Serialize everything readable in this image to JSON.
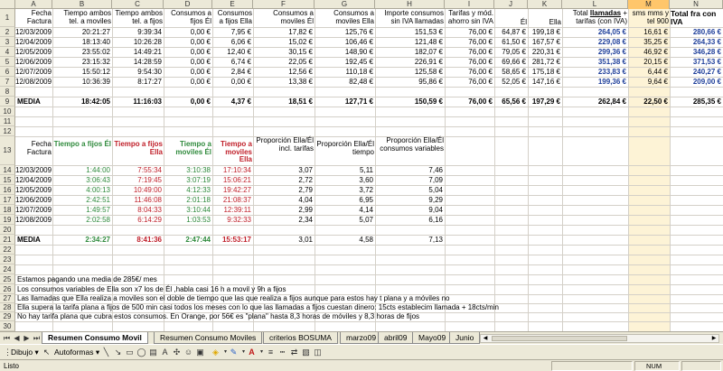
{
  "columns": [
    "A",
    "B",
    "C",
    "D",
    "E",
    "F",
    "G",
    "H",
    "I",
    "J",
    "K",
    "L",
    "M",
    "N"
  ],
  "selected_column": "M",
  "rows": [
    "1",
    "2",
    "3",
    "4",
    "5",
    "6",
    "7",
    "8",
    "9",
    "10",
    "11",
    "12",
    "13",
    "14",
    "15",
    "16",
    "17",
    "18",
    "19",
    "20",
    "21",
    "22",
    "23",
    "24",
    "25",
    "26",
    "27",
    "28",
    "29",
    "30",
    "31"
  ],
  "table1": {
    "headers": {
      "a": "Fecha Factura",
      "b": "Tiempo ambos tel. a moviles",
      "c": "Tiempo ambos tel. a fijos",
      "d": "Consumos a fijos Él",
      "e": "Consumos a fijos Ella",
      "f": "Consumos a moviles Él",
      "g": "Consumos a moviles Ella",
      "h": "Importe consumos sin IVA llamadas",
      "i": "Tarifas y mód. ahorro sin IVA",
      "j": "Él",
      "k": "Ella",
      "l_prefix": "Total ",
      "l_bold": "llamadas",
      "l_suffix": " + tarifas (con IVA)",
      "m": "sms mms y tel 900",
      "n": "Total fra con IVA"
    },
    "rows": [
      [
        "12/03/2009",
        "20:21:27",
        "9:39:34",
        "0,00 €",
        "7,95 €",
        "17,82 €",
        "125,76 €",
        "151,53 €",
        "76,00 €",
        "64,87 €",
        "199,18 €",
        "264,05 €",
        "16,61 €",
        "280,66 €"
      ],
      [
        "12/04/2009",
        "18:13:40",
        "10:26:28",
        "0,00 €",
        "6,06 €",
        "15,02 €",
        "106,46 €",
        "121,48 €",
        "76,00 €",
        "61,50 €",
        "167,57 €",
        "229,08 €",
        "35,25 €",
        "264,33 €"
      ],
      [
        "12/05/2009",
        "23:55:02",
        "14:49:21",
        "0,00 €",
        "12,40 €",
        "30,15 €",
        "148,90 €",
        "182,07 €",
        "76,00 €",
        "79,05 €",
        "220,31 €",
        "299,36 €",
        "46,92 €",
        "346,28 €"
      ],
      [
        "12/06/2009",
        "23:15:32",
        "14:28:59",
        "0,00 €",
        "6,74 €",
        "22,05 €",
        "192,45 €",
        "226,91 €",
        "76,00 €",
        "69,66 €",
        "281,72 €",
        "351,38 €",
        "20,15 €",
        "371,53 €"
      ],
      [
        "12/07/2009",
        "15:50:12",
        "9:54:30",
        "0,00 €",
        "2,84 €",
        "12,56 €",
        "110,18 €",
        "125,58 €",
        "76,00 €",
        "58,65 €",
        "175,18 €",
        "233,83 €",
        "6,44 €",
        "240,27 €"
      ],
      [
        "12/08/2009",
        "10:36:39",
        "8:17:27",
        "0,00 €",
        "0,00 €",
        "13,38 €",
        "82,48 €",
        "95,86 €",
        "76,00 €",
        "52,05 €",
        "147,16 €",
        "199,36 €",
        "9,64 €",
        "209,00 €"
      ]
    ],
    "media": {
      "label": "MEDIA",
      "b": "18:42:05",
      "c": "11:16:03",
      "d": "0,00 €",
      "e": "4,37 €",
      "f": "18,51 €",
      "g": "127,71 €",
      "h": "150,59 €",
      "i": "76,00 €",
      "j": "65,56 €",
      "k": "197,29 €",
      "l": "262,84 €",
      "m": "22,50 €",
      "n": "285,35 €"
    }
  },
  "table2": {
    "headers": {
      "a": "Fecha Factura",
      "b": "Tiempo a fijos Él",
      "c": "Tiempo a fijos Ella",
      "d": "Tiempo a moviles Él",
      "e": "Tiempo a moviles Ella",
      "f": "Proporción Ella/Él incl. tarifas",
      "g": "Proporción Ella/Él tiempo",
      "h": "Proporción Ella/Él consumos variables"
    },
    "rows": [
      [
        "12/03/2009",
        "1:44:00",
        "7:55:34",
        "3:10:38",
        "17:10:34",
        "3,07",
        "5,11",
        "7,46"
      ],
      [
        "12/04/2009",
        "3:06:43",
        "7:19:45",
        "3:07:19",
        "15:06:21",
        "2,72",
        "3,60",
        "7,09"
      ],
      [
        "12/05/2009",
        "4:00:13",
        "10:49:00",
        "4:12:33",
        "19:42:27",
        "2,79",
        "3,72",
        "5,04"
      ],
      [
        "12/06/2009",
        "2:42:51",
        "11:46:08",
        "2:01:18",
        "21:08:37",
        "4,04",
        "6,95",
        "9,29"
      ],
      [
        "12/07/2009",
        "1:49:57",
        "8:04:33",
        "3:10:44",
        "12:39:11",
        "2,99",
        "4,14",
        "9,04"
      ],
      [
        "12/08/2009",
        "2:02:58",
        "6:14:29",
        "1:03:53",
        "9:32:33",
        "2,34",
        "5,07",
        "6,16"
      ]
    ],
    "media": {
      "label": "MEDIA",
      "b": "2:34:27",
      "c": "8:41:36",
      "d": "2:47:44",
      "e": "15:53:17",
      "f": "3,01",
      "g": "4,58",
      "h": "7,13"
    }
  },
  "notes": [
    "Estamos pagando una media de 285€/ mes",
    "Los consumos variables de Ella son x7 los de Él ,habla casi 16 h a movil y 9h a fijos",
    "Las llamadas que Ella realiza a moviles son el doble de tiempo que las que realiza a fijos aunque para estos hay t plana y a móviles no",
    "Ella supera la tarifa plana a fijos de 500 min casi todos los meses con lo que las llamadas a fijos cuestan dinero: 15cts establecim llamada + 18cts/min",
    "No hay tarifa plana que cubra estos consumos. En Orange, por 56€ es \"plana\" hasta 8,3 horas de móviles y 8,3 horas de fijos"
  ],
  "tabs": [
    "Resumen Consumo Movil",
    "Resumen Consumo Moviles",
    "criterios BOSUMA",
    "marzo09",
    "abril09",
    "Mayo09",
    "Junio"
  ],
  "active_tab": "Resumen Consumo Movil",
  "toolbar": {
    "draw_label": "Dibujo ▾",
    "autoshapes_label": "Autoformas ▾"
  },
  "status": {
    "left": "Listo",
    "num": "NUM"
  }
}
